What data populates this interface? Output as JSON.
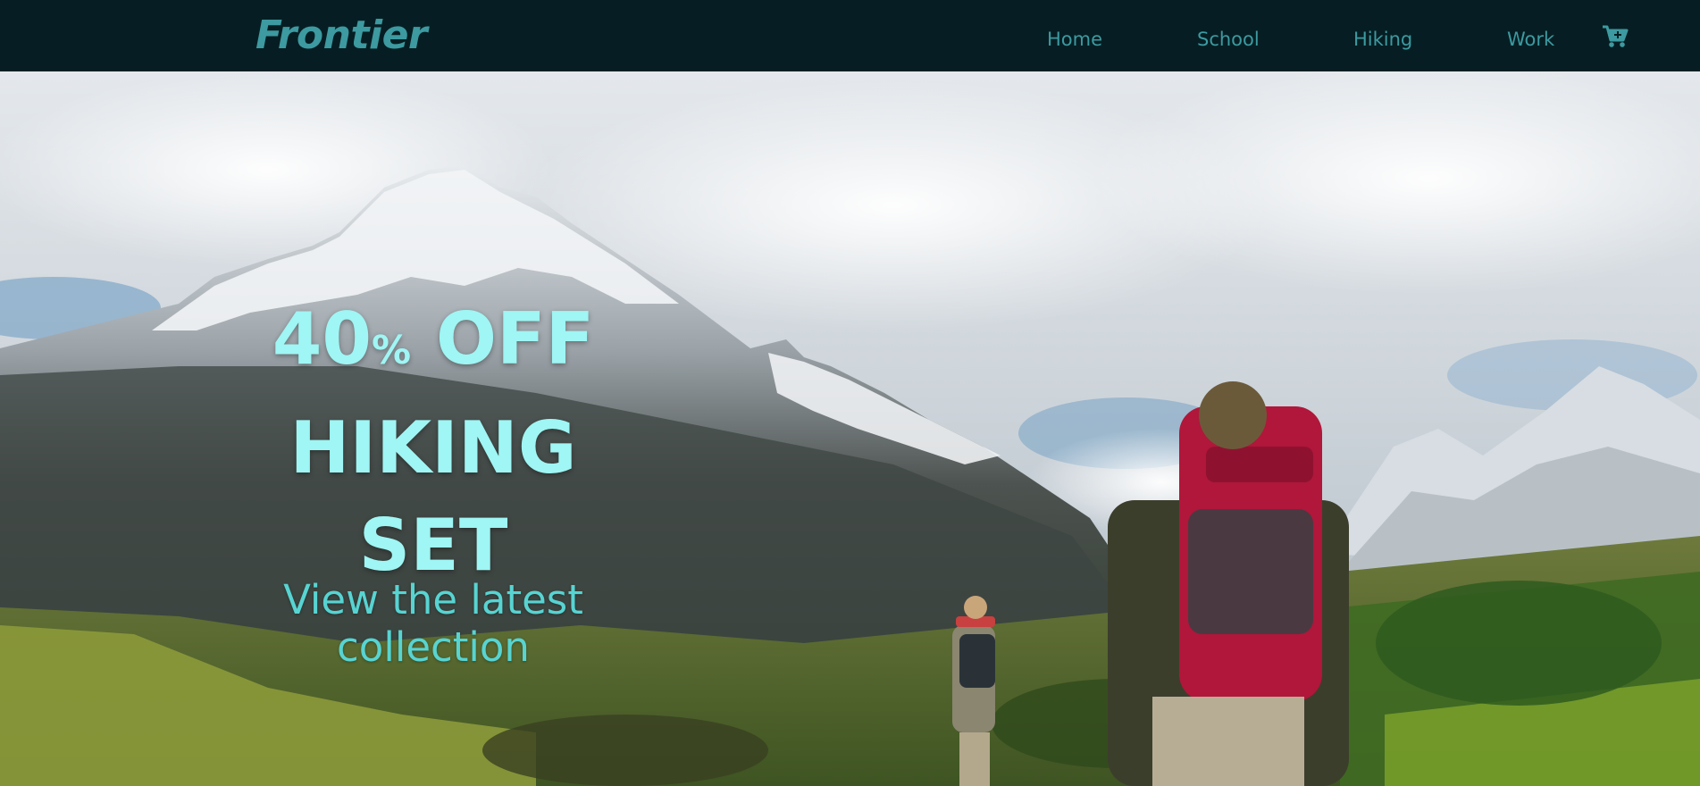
{
  "brand": {
    "name": "Frontier"
  },
  "nav": {
    "items": [
      {
        "label": "Home"
      },
      {
        "label": "School"
      },
      {
        "label": "Hiking"
      },
      {
        "label": "Work"
      }
    ],
    "cart_icon": "cart-plus-icon"
  },
  "hero": {
    "promo": {
      "discount_value": "40",
      "discount_unit": "%",
      "discount_word": "OFF",
      "line2": "HIKING",
      "line3": "SET"
    },
    "cta": "View the latest collection"
  },
  "colors": {
    "nav_bg": "#061e23",
    "nav_text": "#3c9aa0",
    "promo_text": "#9ff6f4",
    "cta_text": "#57d4d2"
  }
}
